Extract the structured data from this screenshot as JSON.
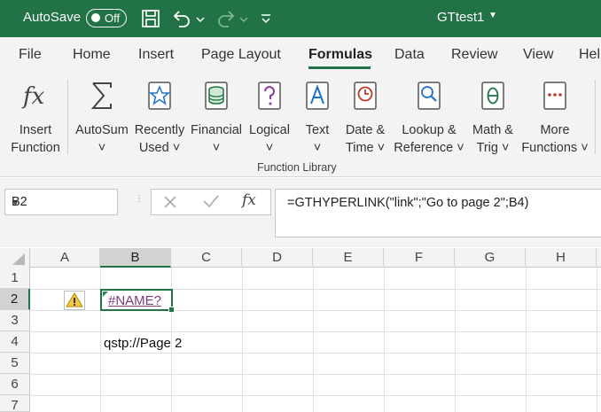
{
  "titlebar": {
    "autosave_label": "AutoSave",
    "autosave_state": "Off",
    "document_title": "GTtest1",
    "icons": [
      "save-icon",
      "undo-icon",
      "undo-dropdown-icon",
      "redo-icon",
      "redo-dropdown-icon",
      "customize-qat-icon"
    ]
  },
  "menu": {
    "tabs": [
      "File",
      "Home",
      "Insert",
      "Page Layout",
      "Formulas",
      "Data",
      "Review",
      "View",
      "Help"
    ],
    "active": "Formulas"
  },
  "ribbon": {
    "insert_function": {
      "line1": "Insert",
      "line2": "Function"
    },
    "autosum": {
      "line1": "AutoSum",
      "line2": "˅"
    },
    "recently_used": {
      "line1": "Recently",
      "line2": "Used ˅"
    },
    "financial": {
      "line1": "Financial",
      "line2": "˅"
    },
    "logical": {
      "line1": "Logical",
      "line2": "˅"
    },
    "text": {
      "line1": "Text",
      "line2": "˅"
    },
    "date_time": {
      "line1": "Date &",
      "line2": "Time ˅"
    },
    "lookup_reference": {
      "line1": "Lookup &",
      "line2": "Reference ˅"
    },
    "math_trig": {
      "line1": "Math &",
      "line2": "Trig ˅"
    },
    "more_functions": {
      "line1": "More",
      "line2": "Functions ˅"
    },
    "group_label": "Function Library",
    "accent_color": "#217346"
  },
  "formula_bar": {
    "name_box": "B2",
    "fx_label": "fx",
    "formula": "=GTHYPERLINK(\"link\";\"Go to page 2\";B4)"
  },
  "grid": {
    "columns": [
      "A",
      "B",
      "C",
      "D",
      "E",
      "F",
      "G",
      "H"
    ],
    "rows": [
      "1",
      "2",
      "3",
      "4",
      "5",
      "6",
      "7"
    ],
    "selected_cell": "B2",
    "cells": {
      "B2": "#NAME?",
      "B4": "qstp://Page 2"
    }
  }
}
